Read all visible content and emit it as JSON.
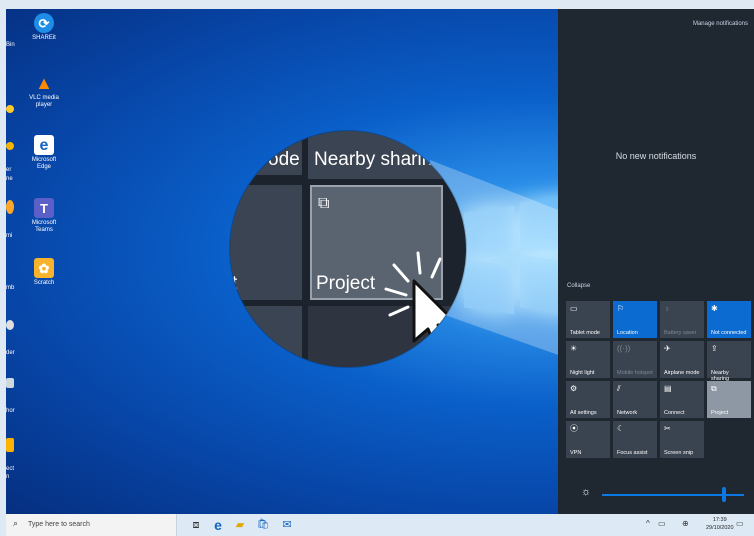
{
  "desktop": {
    "icons": [
      {
        "label": "SHAREit",
        "glyph": "⟳",
        "color": "#1d8de8"
      },
      {
        "label": "VLC media player",
        "glyph": "▲",
        "color": "#ff8a00"
      },
      {
        "label": "Microsoft Edge",
        "glyph": "e",
        "color": "#1565c0"
      },
      {
        "label": "Microsoft Teams",
        "glyph": "T",
        "color": "#5b5fc7"
      },
      {
        "label": "Scratch",
        "glyph": "✿",
        "color": "#f7b32b"
      }
    ],
    "partial_labels": [
      "Bin",
      "er",
      "ne",
      "mi",
      "mb",
      "der",
      "hor",
      "ect",
      "n"
    ]
  },
  "action_center": {
    "manage_label": "Manage notifications",
    "no_notifications": "No new notifications",
    "collapse_label": "Collapse",
    "tiles": [
      {
        "label": "Tablet mode",
        "glyph": "▭",
        "state": "off"
      },
      {
        "label": "Location",
        "glyph": "⚐",
        "state": "on"
      },
      {
        "label": "Battery saver",
        "glyph": "♁",
        "state": "disabled"
      },
      {
        "label": "Not connected",
        "glyph": "✱",
        "state": "on"
      },
      {
        "label": "Night light",
        "glyph": "☀",
        "state": "off"
      },
      {
        "label": "Mobile hotspot",
        "glyph": "((·))",
        "state": "disabled"
      },
      {
        "label": "Airplane mode",
        "glyph": "✈",
        "state": "off"
      },
      {
        "label": "Nearby sharing",
        "glyph": "⇪",
        "state": "off"
      },
      {
        "label": "All settings",
        "glyph": "⚙",
        "state": "off"
      },
      {
        "label": "Network",
        "glyph": "⫽",
        "state": "off"
      },
      {
        "label": "Connect",
        "glyph": "▤",
        "state": "off"
      },
      {
        "label": "Project",
        "glyph": "⧉",
        "state": "highlighted"
      },
      {
        "label": "VPN",
        "glyph": "⦿",
        "state": "off"
      },
      {
        "label": "Focus assist",
        "glyph": "☾",
        "state": "off"
      },
      {
        "label": "Screen snip",
        "glyph": "✂",
        "state": "off"
      }
    ],
    "brightness": {
      "glyph": "☼",
      "level": 1.0
    }
  },
  "magnifier": {
    "top_left_text": "ode",
    "top_right_text": "Nearby sharing",
    "left_text": "t",
    "project_label": "Project",
    "project_glyph": "⧉"
  },
  "taskbar": {
    "search_placeholder": "Type here to search",
    "search_glyph": "⌕",
    "task_view_glyph": "⧈",
    "edge_glyph": "e",
    "explorer_glyph": "▰",
    "store_glyph": "🛍",
    "mail_glyph": "✉",
    "tray_chevron": "^",
    "tray_network": "▭",
    "tray_language": "⊕",
    "time": "17:39",
    "date": "29/10/2020",
    "notification_glyph": "▭"
  },
  "colors": {
    "accent": "#0b6bd0",
    "panel": "#1f2731",
    "tile": "#3a4350"
  }
}
